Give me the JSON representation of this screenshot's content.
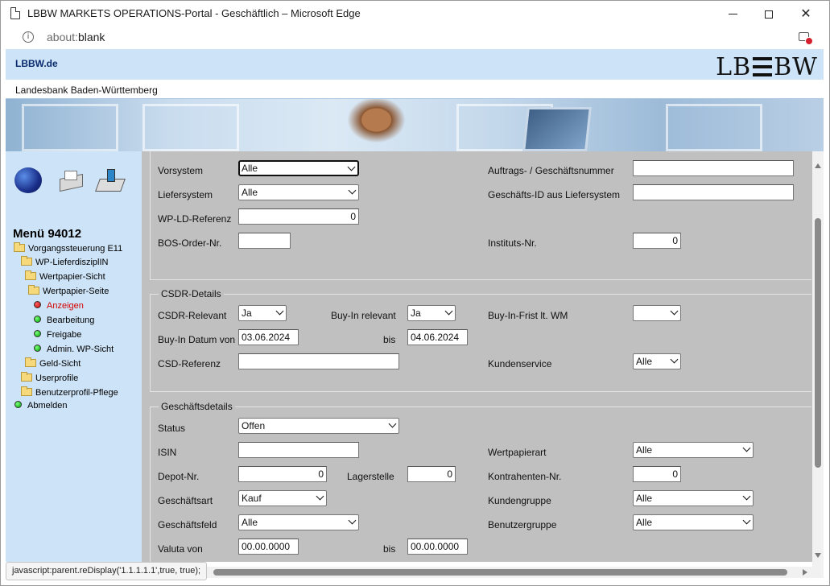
{
  "window": {
    "title": "LBBW MARKETS OPERATIONS-Portal - Geschäftlich – Microsoft Edge",
    "url_prefix": "about:",
    "url_main": "blank"
  },
  "header": {
    "site_link": "LBBW.de",
    "logo_left": "LB",
    "logo_right": "BW",
    "bank_name": "Landesbank Baden-Württemberg"
  },
  "sidebar": {
    "menu_title": "Menü 94012",
    "items": [
      {
        "label": "Vorgangssteuerung E11",
        "kind": "folder"
      },
      {
        "label": "WP-LieferdisziplIN",
        "kind": "folder"
      },
      {
        "label": "Wertpapier-Sicht",
        "kind": "folder"
      },
      {
        "label": "Wertpapier-Seite",
        "kind": "folder"
      },
      {
        "label": "Anzeigen",
        "kind": "dot-red"
      },
      {
        "label": "Bearbeitung",
        "kind": "dot-green"
      },
      {
        "label": "Freigabe",
        "kind": "dot-green"
      },
      {
        "label": "Admin. WP-Sicht",
        "kind": "dot-green"
      },
      {
        "label": "Geld-Sicht",
        "kind": "folder"
      },
      {
        "label": "Userprofile",
        "kind": "folder"
      },
      {
        "label": "Benutzerprofil-Pflege",
        "kind": "folder"
      },
      {
        "label": "Abmelden",
        "kind": "dot-green"
      }
    ]
  },
  "form": {
    "top": {
      "vorsystem": {
        "label": "Vorsystem",
        "value": "Alle"
      },
      "liefersystem": {
        "label": "Liefersystem",
        "value": "Alle"
      },
      "wp_ld_referenz": {
        "label": "WP-LD-Referenz",
        "value": "0"
      },
      "bos_order_nr": {
        "label": "BOS-Order-Nr.",
        "value": ""
      },
      "auftrags_nr": {
        "label": "Auftrags- / Geschäftsnummer",
        "value": ""
      },
      "geschaefts_id": {
        "label": "Geschäfts-ID aus Liefersystem",
        "value": ""
      },
      "instituts_nr": {
        "label": "Instituts-Nr.",
        "value": "0"
      }
    },
    "csdr": {
      "legend": "CSDR-Details",
      "csdr_relevant": {
        "label": "CSDR-Relevant",
        "value": "Ja"
      },
      "buy_in_relevant": {
        "label": "Buy-In relevant",
        "value": "Ja"
      },
      "buy_in_frist": {
        "label": "Buy-In-Frist lt. WM",
        "value": ""
      },
      "buy_in_datum_von": {
        "label": "Buy-In Datum von",
        "value": "03.06.2024"
      },
      "bis_label": "bis",
      "buy_in_datum_bis": "04.06.2024",
      "csd_referenz": {
        "label": "CSD-Referenz",
        "value": ""
      },
      "kundenservice": {
        "label": "Kundenservice",
        "value": "Alle"
      }
    },
    "geschaeft": {
      "legend": "Geschäftsdetails",
      "status": {
        "label": "Status",
        "value": "Offen"
      },
      "isin": {
        "label": "ISIN",
        "value": ""
      },
      "wertpapierart": {
        "label": "Wertpapierart",
        "value": "Alle"
      },
      "depot_nr": {
        "label": "Depot-Nr.",
        "value": "0"
      },
      "lagerstelle": {
        "label": "Lagerstelle",
        "value": "0"
      },
      "kontrahenten_nr": {
        "label": "Kontrahenten-Nr.",
        "value": "0"
      },
      "geschaeftsart": {
        "label": "Geschäftsart",
        "value": "Kauf"
      },
      "kundengruppe": {
        "label": "Kundengruppe",
        "value": "Alle"
      },
      "geschaeftsfeld": {
        "label": "Geschäftsfeld",
        "value": "Alle"
      },
      "benutzergruppe": {
        "label": "Benutzergruppe",
        "value": "Alle"
      },
      "valuta_von": {
        "label": "Valuta von",
        "value": "00.00.0000"
      },
      "bis_label": "bis",
      "valuta_bis": "00.00.0000"
    }
  },
  "statusbar": "javascript:parent.reDisplay('1.1.1.1.1',true, true);"
}
